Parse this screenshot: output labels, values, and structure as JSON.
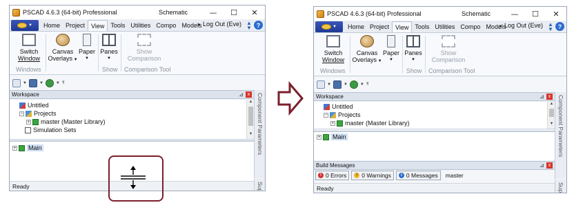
{
  "app_title": "PSCAD 4.6.3 (64-bit) Professional",
  "doc_title": "Schematic",
  "window_buttons": {
    "minimize": "—",
    "maximize": "☐",
    "close": "✕"
  },
  "ribbon_tabs": [
    "Home",
    "Project",
    "View",
    "Tools",
    "Utilities",
    "Compo",
    "Models"
  ],
  "active_tab": "View",
  "logout": "Log Out (Eve)",
  "help": "?",
  "ribbon": {
    "switch_window": [
      "Switch",
      "Window"
    ],
    "canvas_overlays": [
      "Canvas",
      "Overlays"
    ],
    "paper": "Paper",
    "panes": "Panes",
    "show_comparison": [
      "Show",
      "Comparison"
    ],
    "groups": {
      "windows": "Windows",
      "show": "Show",
      "comparison_tool": "Comparison Tool"
    }
  },
  "workspace": {
    "title": "Workspace",
    "tree": {
      "untitled": "Untitled",
      "projects": "Projects",
      "master": "master (Master Library)",
      "simulation_sets": "Simulation Sets",
      "main": "Main"
    }
  },
  "build_messages": {
    "title": "Build Messages",
    "errors": "0 Errors",
    "warnings": "0 Warnings",
    "messages": "0 Messages",
    "project": "master"
  },
  "side_panels": {
    "component_parameters": "Component Parameters",
    "support": "Supp"
  },
  "status": "Ready",
  "colors": {
    "highlight_box": "#7a1f2b",
    "arrow": "#7a1f2b",
    "file_button": "#1f3a93"
  }
}
